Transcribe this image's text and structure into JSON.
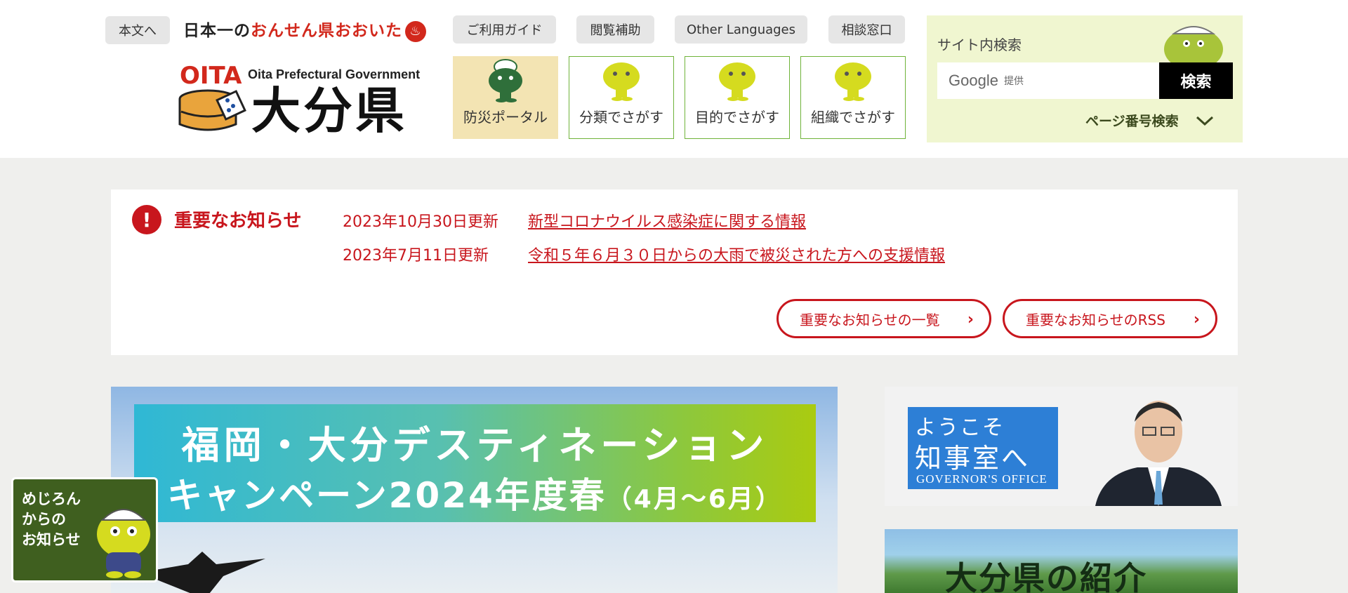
{
  "header": {
    "skip_label": "本文へ",
    "tagline_prefix": "日本一の",
    "tagline_red": "おんせん県おおいた",
    "onsen_mark": "♨",
    "logo_sub": "Oita Prefectural Government",
    "logo_main": "大分県",
    "logo_mark_text": "OITA",
    "utility_links": [
      "ご利用ガイド",
      "閲覧補助",
      "Other Languages",
      "相談窓口"
    ],
    "nav": [
      {
        "label": "防災ポータル",
        "icon": "mejiron-helmet-icon"
      },
      {
        "label": "分類でさがす",
        "icon": "mejiron-icon"
      },
      {
        "label": "目的でさがす",
        "icon": "mejiron-icon"
      },
      {
        "label": "組織でさがす",
        "icon": "mejiron-icon"
      }
    ]
  },
  "search": {
    "title": "サイト内検索",
    "google_label": "Google",
    "provided_label": "提供",
    "button": "検索",
    "page_number_label": "ページ番号検索"
  },
  "notice": {
    "title": "重要なお知らせ",
    "items": [
      {
        "date": "2023年10月30日更新",
        "text": "新型コロナウイルス感染症に関する情報"
      },
      {
        "date": "2023年7月11日更新",
        "text": "令和５年６月３０日からの大雨で被災された方への支援情報"
      }
    ],
    "list_button": "重要なお知らせの一覧",
    "rss_button": "重要なお知らせのRSS"
  },
  "hero": {
    "line1": "福岡・大分デスティネーション",
    "line2_main": "キャンペーン2024年度春",
    "line2_sub": "（4月～6月）"
  },
  "governor": {
    "line1": "ようこそ",
    "line2": "知事室へ",
    "line3": "GOVERNOR'S OFFICE"
  },
  "intro": {
    "text": "大分県の紹介"
  },
  "mejiron": {
    "line1": "めじろん",
    "line2": "からの",
    "line3": "お知らせ"
  },
  "colors": {
    "accent_red": "#c8161d",
    "nav_green": "#6fb33a",
    "search_bg": "#f0f6d0",
    "mascot": "#d5db1f"
  }
}
